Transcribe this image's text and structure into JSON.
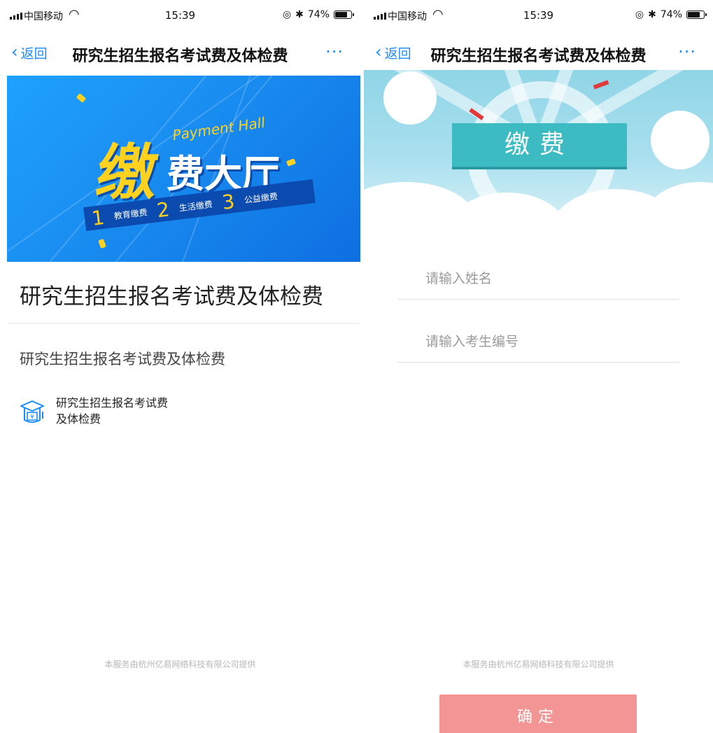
{
  "left": {
    "status": {
      "carrier": "中国移动",
      "time": "15:39",
      "battery": "74%"
    },
    "nav": {
      "back": "返回",
      "title": "研究生招生报名考试费及体检费",
      "more": "···"
    },
    "banner": {
      "headline_big": "缴",
      "headline_rest": "费大厅",
      "english": "Payment Hall",
      "items": [
        {
          "num": "1",
          "text": "教育缴费"
        },
        {
          "num": "2",
          "text": "生活缴费"
        },
        {
          "num": "3",
          "text": "公益缴费"
        }
      ]
    },
    "page_title": "研究生招生报名考试费及体检费",
    "sub_title": "研究生招生报名考试费及体检费",
    "service_item": "研究生招生报名考试费及体检费",
    "footer": "本服务由杭州亿易网络科技有限公司提供"
  },
  "right": {
    "status": {
      "carrier": "中国移动",
      "time": "15:39",
      "battery": "74%"
    },
    "nav": {
      "back": "返回",
      "title": "研究生招生报名考试费及体检费",
      "more": "···"
    },
    "header_title": "缴费",
    "name_placeholder": "请输入姓名",
    "id_placeholder": "请输入考生编号",
    "footer": "本服务由杭州亿易网络科技有限公司提供",
    "confirm": "确定"
  },
  "colors": {
    "link": "#1a8cff",
    "confirm": "#f49595",
    "banner": "#1a8ff2",
    "header_ribbon": "#3cbcc2"
  },
  "battery_level": 0.74
}
